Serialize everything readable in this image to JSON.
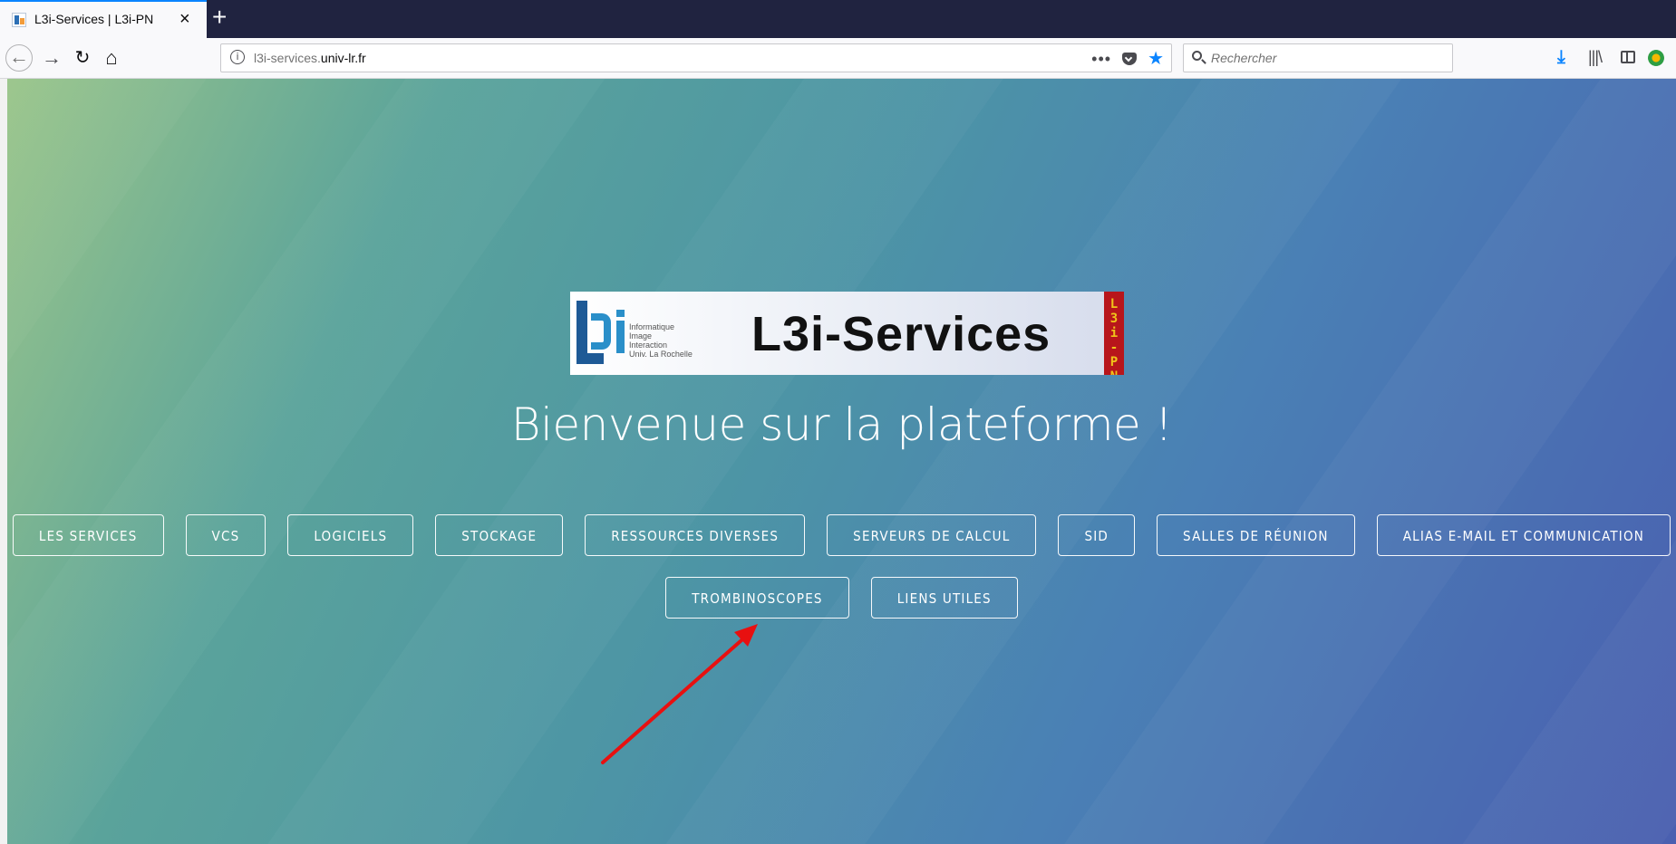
{
  "browser": {
    "tab": {
      "title": "L3i-Services | L3i-PN",
      "close": "×"
    },
    "new_tab": "+",
    "url": {
      "prefix": "l3i-services.",
      "domain": "univ-lr.fr"
    },
    "url_dots": "•••",
    "search_placeholder": "Rechercher",
    "icons": {
      "back": "←",
      "forward": "→",
      "reload": "↻",
      "home": "⌂",
      "star": "★",
      "download": "⤓",
      "library": "|||\\"
    },
    "accent_color": "#0a84ff"
  },
  "page": {
    "banner": {
      "logo_text": "Informatique\nImage\nInteraction\nUniv. La Rochelle",
      "title": "L3i-Services",
      "tag": "L\n3\ni\n-\nP\nN"
    },
    "welcome": "Bienvenue sur la plateforme !",
    "nav_row_1": [
      "LES SERVICES",
      "VCS",
      "LOGICIELS",
      "STOCKAGE",
      "RESSOURCES DIVERSES",
      "SERVEURS DE CALCUL",
      "SID",
      "SALLES DE RÉUNION",
      "ALIAS E-MAIL ET COMMUNICATION"
    ],
    "nav_row_2": [
      "TROMBINOSCOPES",
      "LIENS UTILES"
    ],
    "annotation_arrow_color": "#e81010"
  }
}
